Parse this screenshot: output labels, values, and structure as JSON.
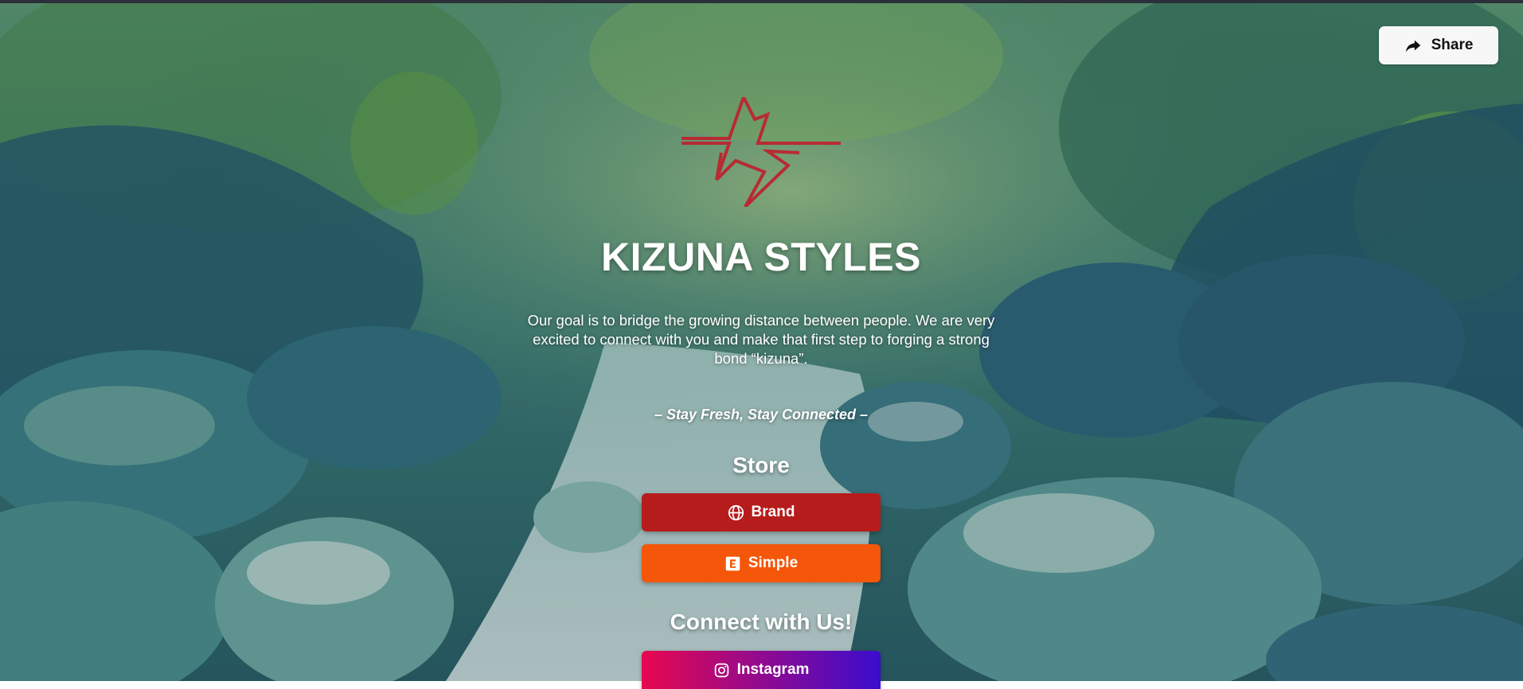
{
  "profile": {
    "title": "KIZUNA STYLES",
    "description": "Our goal is to bridge the growing distance between people. We are very excited to connect with you and make that first step to forging a strong bond “kizuna”.",
    "tagline": "– Stay Fresh, Stay Connected –",
    "logo_icon": "stylized-star-logo"
  },
  "share": {
    "label": "Share",
    "icon": "share-arrow-icon"
  },
  "sections": {
    "store": {
      "heading": "Store",
      "links": [
        {
          "label": "Brand",
          "icon": "globe-icon",
          "color": "#b71c1c"
        },
        {
          "label": "Simple",
          "icon": "etsy-icon",
          "color": "#f4560a"
        }
      ]
    },
    "connect": {
      "heading": "Connect with Us!",
      "links": [
        {
          "label": "Instagram",
          "icon": "instagram-icon",
          "color_start": "#e8084f",
          "color_end": "#3a0ccf"
        }
      ]
    }
  },
  "colors": {
    "logo": "#b72b33",
    "background_primary": "#2e6b6b",
    "background_accent": "#7ab83a"
  }
}
